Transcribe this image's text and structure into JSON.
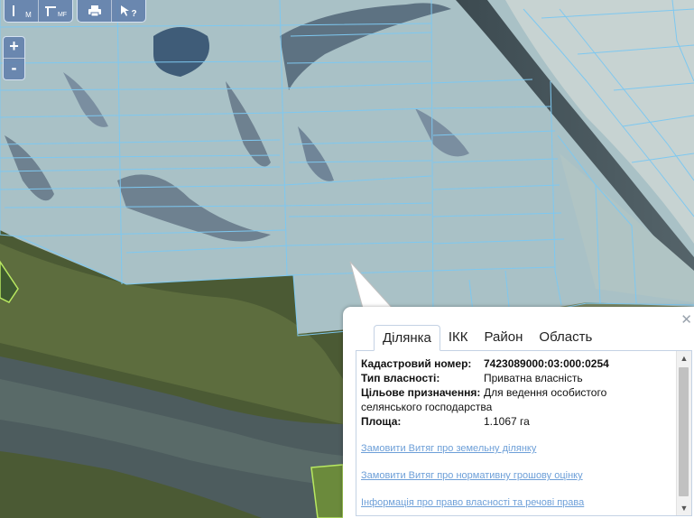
{
  "toolbar": {
    "buttons": [
      {
        "name": "measure-length-button",
        "label": "M"
      },
      {
        "name": "measure-area-button",
        "label": "MF"
      },
      {
        "name": "print-button",
        "label": ""
      },
      {
        "name": "identify-button",
        "label": "?"
      }
    ]
  },
  "zoom": {
    "in": "+",
    "out": "-"
  },
  "popup": {
    "close": "✕",
    "tabs": [
      "Ділянка",
      "ІКК",
      "Район",
      "Область"
    ],
    "active_tab": "Ділянка",
    "fields": {
      "cadastral_label": "Кадастровий номер:",
      "cadastral_value": "7423089000:03:000:0254",
      "ownership_label": "Тип власності:",
      "ownership_value": "Приватна власність",
      "purpose_label": "Цільове призначення:",
      "purpose_value": "Для ведення особистого",
      "purpose_value_cont": "селянського господарства",
      "area_label": "Площа:",
      "area_value": "1.1067 га"
    },
    "links": [
      "Замовити Витяг про земельну ділянку",
      "Замовити Витяг про нормативну грошову оцінку",
      "Інформація про право власності та речові права"
    ]
  }
}
